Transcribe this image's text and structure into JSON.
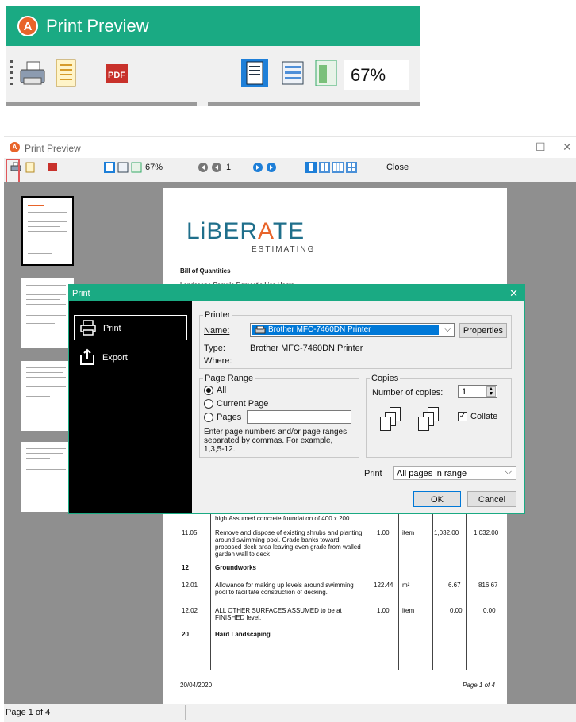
{
  "zoom": {
    "title": "Print Preview",
    "zoom_level": "67%"
  },
  "window": {
    "title": "Print Preview",
    "controls": {
      "minimize": "—",
      "maximize": "☐",
      "close": "✕"
    },
    "toolbar": {
      "zoom_level": "67%",
      "page_number": "1",
      "close_label": "Close"
    },
    "status": "Page 1 of 4"
  },
  "page": {
    "brand": "LiBERATE",
    "brand_sub": "ESTIMATING",
    "heading": "Bill of Quantities",
    "project": "Landscape Sample Domestic Liss Hants",
    "rows": [
      {
        "ref": "",
        "desc": "high.Assumed concrete foundation of 400 x 200",
        "qty": "",
        "unit": "",
        "rate": "",
        "total": ""
      },
      {
        "ref": "11.05",
        "desc": "Remove and dispose of existing shrubs and planting around swimming pool. Grade banks toward proposed deck area leaving even grade from walled garden wall to deck",
        "qty": "1.00",
        "unit": "item",
        "rate": "1,032.00",
        "total": "1,032.00"
      },
      {
        "ref": "12",
        "desc": "Groundworks",
        "qty": "",
        "unit": "",
        "rate": "",
        "total": ""
      },
      {
        "ref": "12.01",
        "desc": "Allowance for making up levels around swimming pool to facilitate construction of decking.",
        "qty": "122.44",
        "unit": "m²",
        "rate": "6.67",
        "total": "816.67"
      },
      {
        "ref": "12.02",
        "desc": "ALL OTHER SURFACES ASSUMED to be at FINISHED level.",
        "qty": "1.00",
        "unit": "item",
        "rate": "0.00",
        "total": "0.00"
      },
      {
        "ref": "20",
        "desc": "Hard Landscaping",
        "qty": "",
        "unit": "",
        "rate": "",
        "total": ""
      }
    ],
    "footer_date": "20/04/2020",
    "footer_page": "Page 1 of 4"
  },
  "dialog": {
    "title": "Print",
    "nav": {
      "print": "Print",
      "export": "Export"
    },
    "printer_group": "Printer",
    "name_label": "Name:",
    "name_value": "Brother MFC-7460DN Printer",
    "properties": "Properties",
    "type_label": "Type:",
    "type_value": "Brother MFC-7460DN Printer",
    "where_label": "Where:",
    "page_range_group": "Page Range",
    "all": "All",
    "current_page": "Current Page",
    "pages": "Pages",
    "hint": "Enter page numbers and/or page ranges separated by commas.  For example, 1,3,5-12.",
    "copies_group": "Copies",
    "num_copies_label": "Number of copies:",
    "num_copies": "1",
    "collate": "Collate",
    "print_label": "Print",
    "print_value": "All pages in range",
    "ok": "OK",
    "cancel": "Cancel"
  }
}
